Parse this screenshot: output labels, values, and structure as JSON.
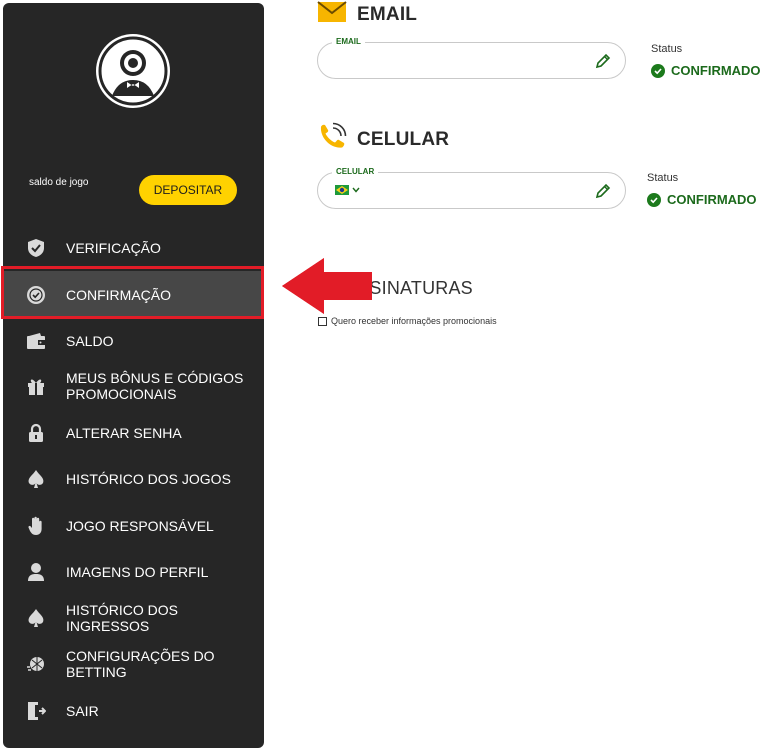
{
  "sidebar": {
    "balance_label": "saldo de jogo",
    "deposit_label": "DEPOSITAR",
    "items": [
      {
        "label": "VERIFICAÇÃO",
        "icon": "shield-check-icon"
      },
      {
        "label": "CONFIRMAÇÃO",
        "icon": "check-badge-icon",
        "active": true
      },
      {
        "label": "SALDO",
        "icon": "wallet-icon"
      },
      {
        "label": "MEUS BÔNUS E CÓDIGOS PROMOCIONAIS",
        "icon": "gift-icon"
      },
      {
        "label": "ALTERAR SENHA",
        "icon": "lock-icon"
      },
      {
        "label": "HISTÓRICO DOS JOGOS",
        "icon": "spade-icon"
      },
      {
        "label": "JOGO RESPONSÁVEL",
        "icon": "hand-icon"
      },
      {
        "label": "IMAGENS DO PERFIL",
        "icon": "user-icon"
      },
      {
        "label": "HISTÓRICO DOS INGRESSOS",
        "icon": "spade-icon"
      },
      {
        "label": "CONFIGURAÇÕES DO BETTING",
        "icon": "ball-icon"
      },
      {
        "label": "SAIR",
        "icon": "exit-door-icon"
      }
    ]
  },
  "email": {
    "title": "EMAIL",
    "field_label": "EMAIL",
    "field_value": "",
    "status_label": "Status",
    "status_value": "CONFIRMADO"
  },
  "phone": {
    "title": "CELULAR",
    "field_label": "CELULAR",
    "field_value": "",
    "status_label": "Status",
    "status_value": "CONFIRMADO"
  },
  "subscriptions": {
    "title": "ASSINATURAS",
    "checkbox_label": "Quero receber informações promocionais"
  },
  "colors": {
    "sidebar_bg": "#262626",
    "accent_yellow": "#ffd200",
    "confirmed_green": "#1c6a1c",
    "highlight_red": "#e21c27"
  }
}
